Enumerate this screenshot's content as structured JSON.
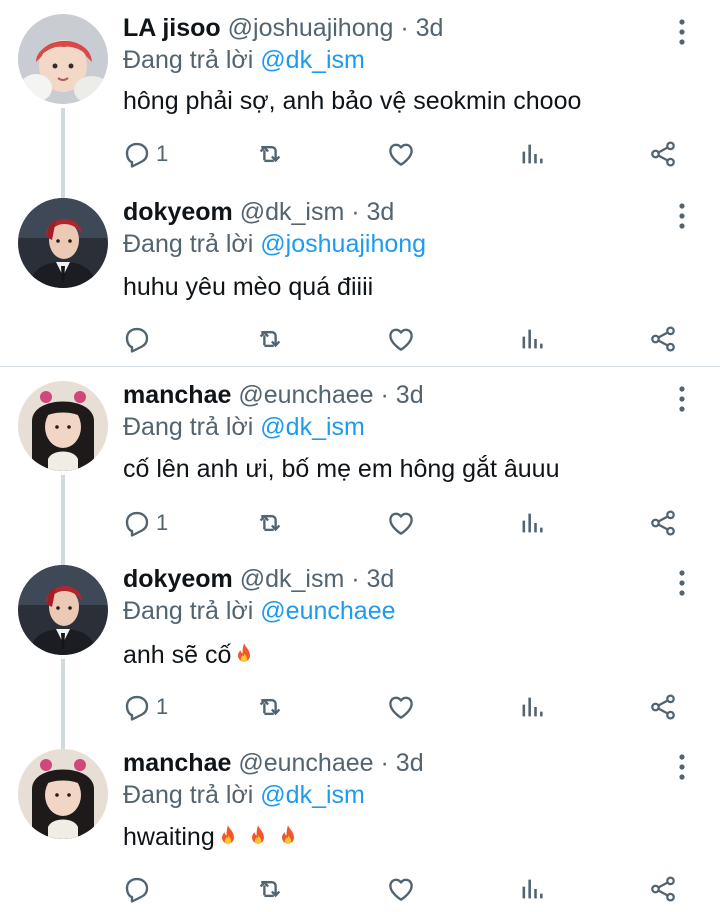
{
  "tweets": [
    {
      "name": "LA jisoo",
      "handle": "@joshuajihong",
      "sep": "·",
      "time": "3d",
      "reply_prefix": "Đang trả lời",
      "reply_to": "@dk_ism",
      "text": "hông phải sợ, anh bảo vệ seokmin chooo",
      "reply_count": "1",
      "flames": 0
    },
    {
      "name": "dokyeom",
      "handle": "@dk_ism",
      "sep": "·",
      "time": "3d",
      "reply_prefix": "Đang trả lời",
      "reply_to": "@joshuajihong",
      "text": "huhu yêu mèo quá điiii",
      "reply_count": "",
      "flames": 0
    },
    {
      "name": "manchae",
      "handle": "@eunchaee",
      "sep": "·",
      "time": "3d",
      "reply_prefix": "Đang trả lời",
      "reply_to": "@dk_ism",
      "text": "cố lên anh ưi, bố mẹ em hông gắt âuuu",
      "reply_count": "1",
      "flames": 0
    },
    {
      "name": "dokyeom",
      "handle": "@dk_ism",
      "sep": "·",
      "time": "3d",
      "reply_prefix": "Đang trả lời",
      "reply_to": "@eunchaee",
      "text": "anh sẽ cố",
      "reply_count": "1",
      "flames": 1
    },
    {
      "name": "manchae",
      "handle": "@eunchaee",
      "sep": "·",
      "time": "3d",
      "reply_prefix": "Đang trả lời",
      "reply_to": "@dk_ism",
      "text": "hwaiting",
      "reply_count": "",
      "flames": 3
    }
  ],
  "icons": {
    "reply": "reply-icon",
    "retweet": "retweet-icon",
    "like": "heart-icon",
    "analytics": "analytics-icon",
    "share": "share-icon",
    "more": "more-vertical-icon",
    "emoji": "fire-emoji"
  },
  "colors": {
    "mention": "#1d9bf0",
    "secondary_text": "#536471",
    "icon": "#536471",
    "thread_line": "#cfd9de"
  }
}
